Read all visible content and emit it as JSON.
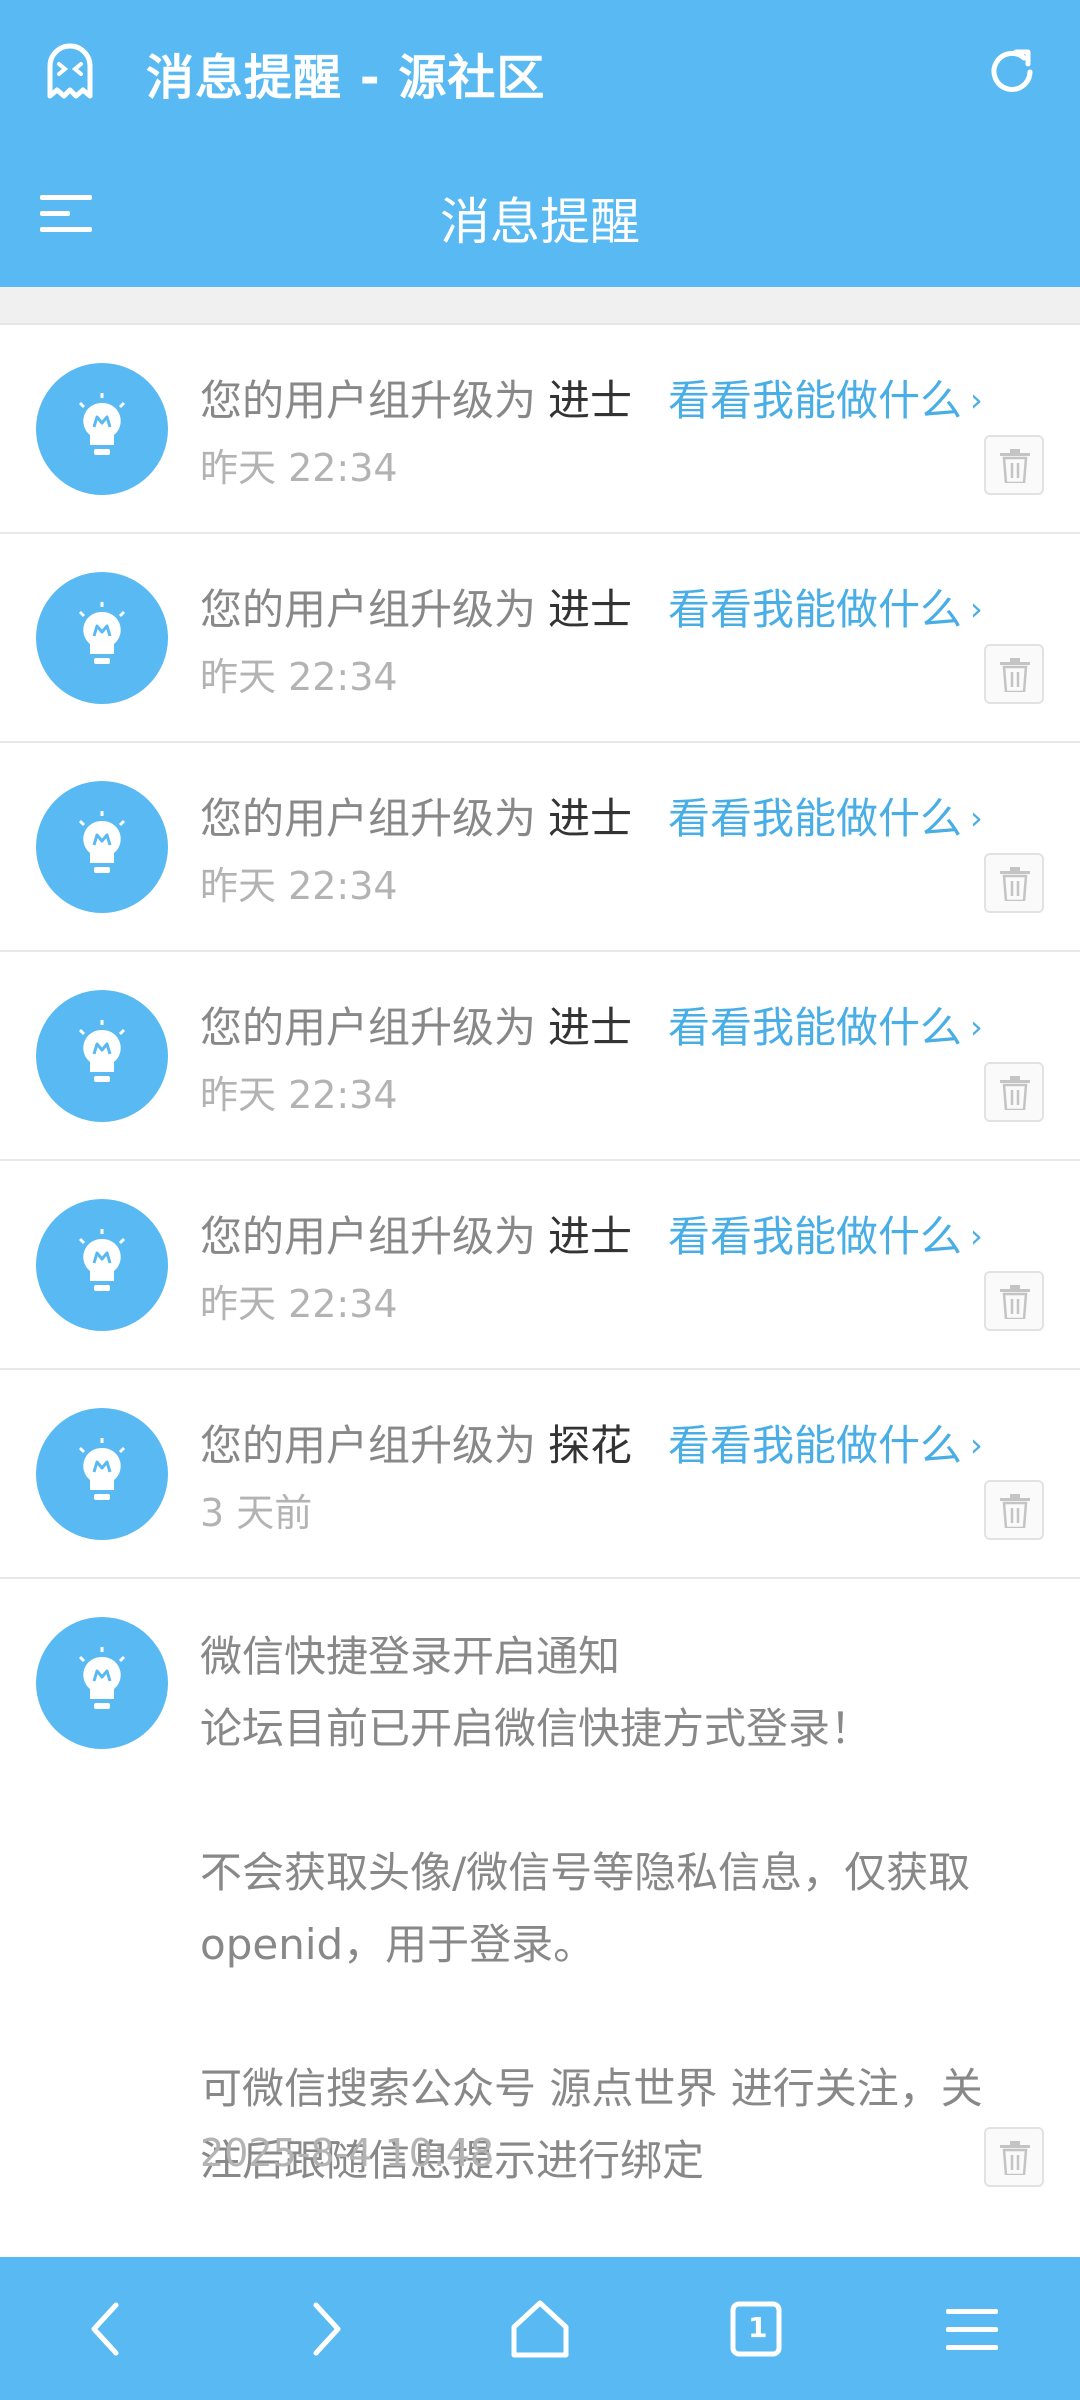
{
  "app_bar": {
    "title": "消息提醒 - 源社区"
  },
  "nav_bar": {
    "title": "消息提醒"
  },
  "notifications": [
    {
      "prefix": "您的用户组升级为",
      "group": "进士",
      "link": "看看我能做什么",
      "time": "昨天 22:34"
    },
    {
      "prefix": "您的用户组升级为",
      "group": "进士",
      "link": "看看我能做什么",
      "time": "昨天 22:34"
    },
    {
      "prefix": "您的用户组升级为",
      "group": "进士",
      "link": "看看我能做什么",
      "time": "昨天 22:34"
    },
    {
      "prefix": "您的用户组升级为",
      "group": "进士",
      "link": "看看我能做什么",
      "time": "昨天 22:34"
    },
    {
      "prefix": "您的用户组升级为",
      "group": "进士",
      "link": "看看我能做什么",
      "time": "昨天 22:34"
    },
    {
      "prefix": "您的用户组升级为",
      "group": "探花",
      "link": "看看我能做什么",
      "time": "3 天前"
    }
  ],
  "long_notice": {
    "title": "微信快捷登录开启通知",
    "line1": "论坛目前已开启微信快捷方式登录！",
    "line2": "不会获取头像/微信号等隐私信息，仅获取",
    "line3": "openid，用于登录。",
    "line4": "可微信搜索公众号 源点世界 进行关注，关",
    "line5": "注后跟随信息提示进行绑定",
    "time": "2025-8-4 10:48"
  },
  "bottom_bar": {
    "tab_count": "1"
  },
  "colors": {
    "primary": "#59b9f2",
    "link": "#4aaee6"
  }
}
